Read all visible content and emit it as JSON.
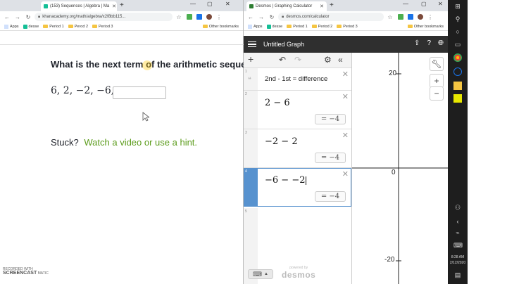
{
  "left_window": {
    "tab_title": "(153) Sequences | Algebra | Ma",
    "url": "khanacademy.org/math/algebra/x2f8bb115...",
    "bookmarks": [
      "Apps",
      "desse",
      "Period 1",
      "Perod 2",
      "Period 3"
    ],
    "other_bookmarks": "Other bookmarks",
    "question": "What is the next term of the arithmetic sequen",
    "sequence": "6, 2, −2, −6,",
    "answer_value": "",
    "stuck_label": "Stuck?",
    "hint_link": "Watch a video or use a hint."
  },
  "right_window": {
    "tab_title": "Desmos | Graphing Calculator",
    "url": "desmos.com/calculator",
    "bookmarks": [
      "Apps",
      "desse",
      "Period 1",
      "Period 2",
      "Period 3"
    ],
    "other_bookmarks": "Other bookmarks",
    "graph_title": "Untitled Graph",
    "expressions": [
      {
        "index": "1",
        "note": "2nd - 1st = difference"
      },
      {
        "index": "2",
        "math": "2 − 6",
        "result": "= −4"
      },
      {
        "index": "3",
        "math": "−2 − 2",
        "result": "= −4"
      },
      {
        "index": "4",
        "math": "−6 − −2",
        "result": "= −4"
      },
      {
        "index": "5"
      }
    ],
    "powered_by": "powered by",
    "brand": "desmos",
    "axis_labels": {
      "y_top": "20",
      "origin": "0",
      "y_bottom": "-20"
    }
  },
  "taskbar": {
    "time": "8:28 AM",
    "date": "2/12/2020"
  },
  "watermark": {
    "line1": "RECORDED WITH",
    "line2": "SCREENCAST",
    "line3": "MATIC"
  }
}
